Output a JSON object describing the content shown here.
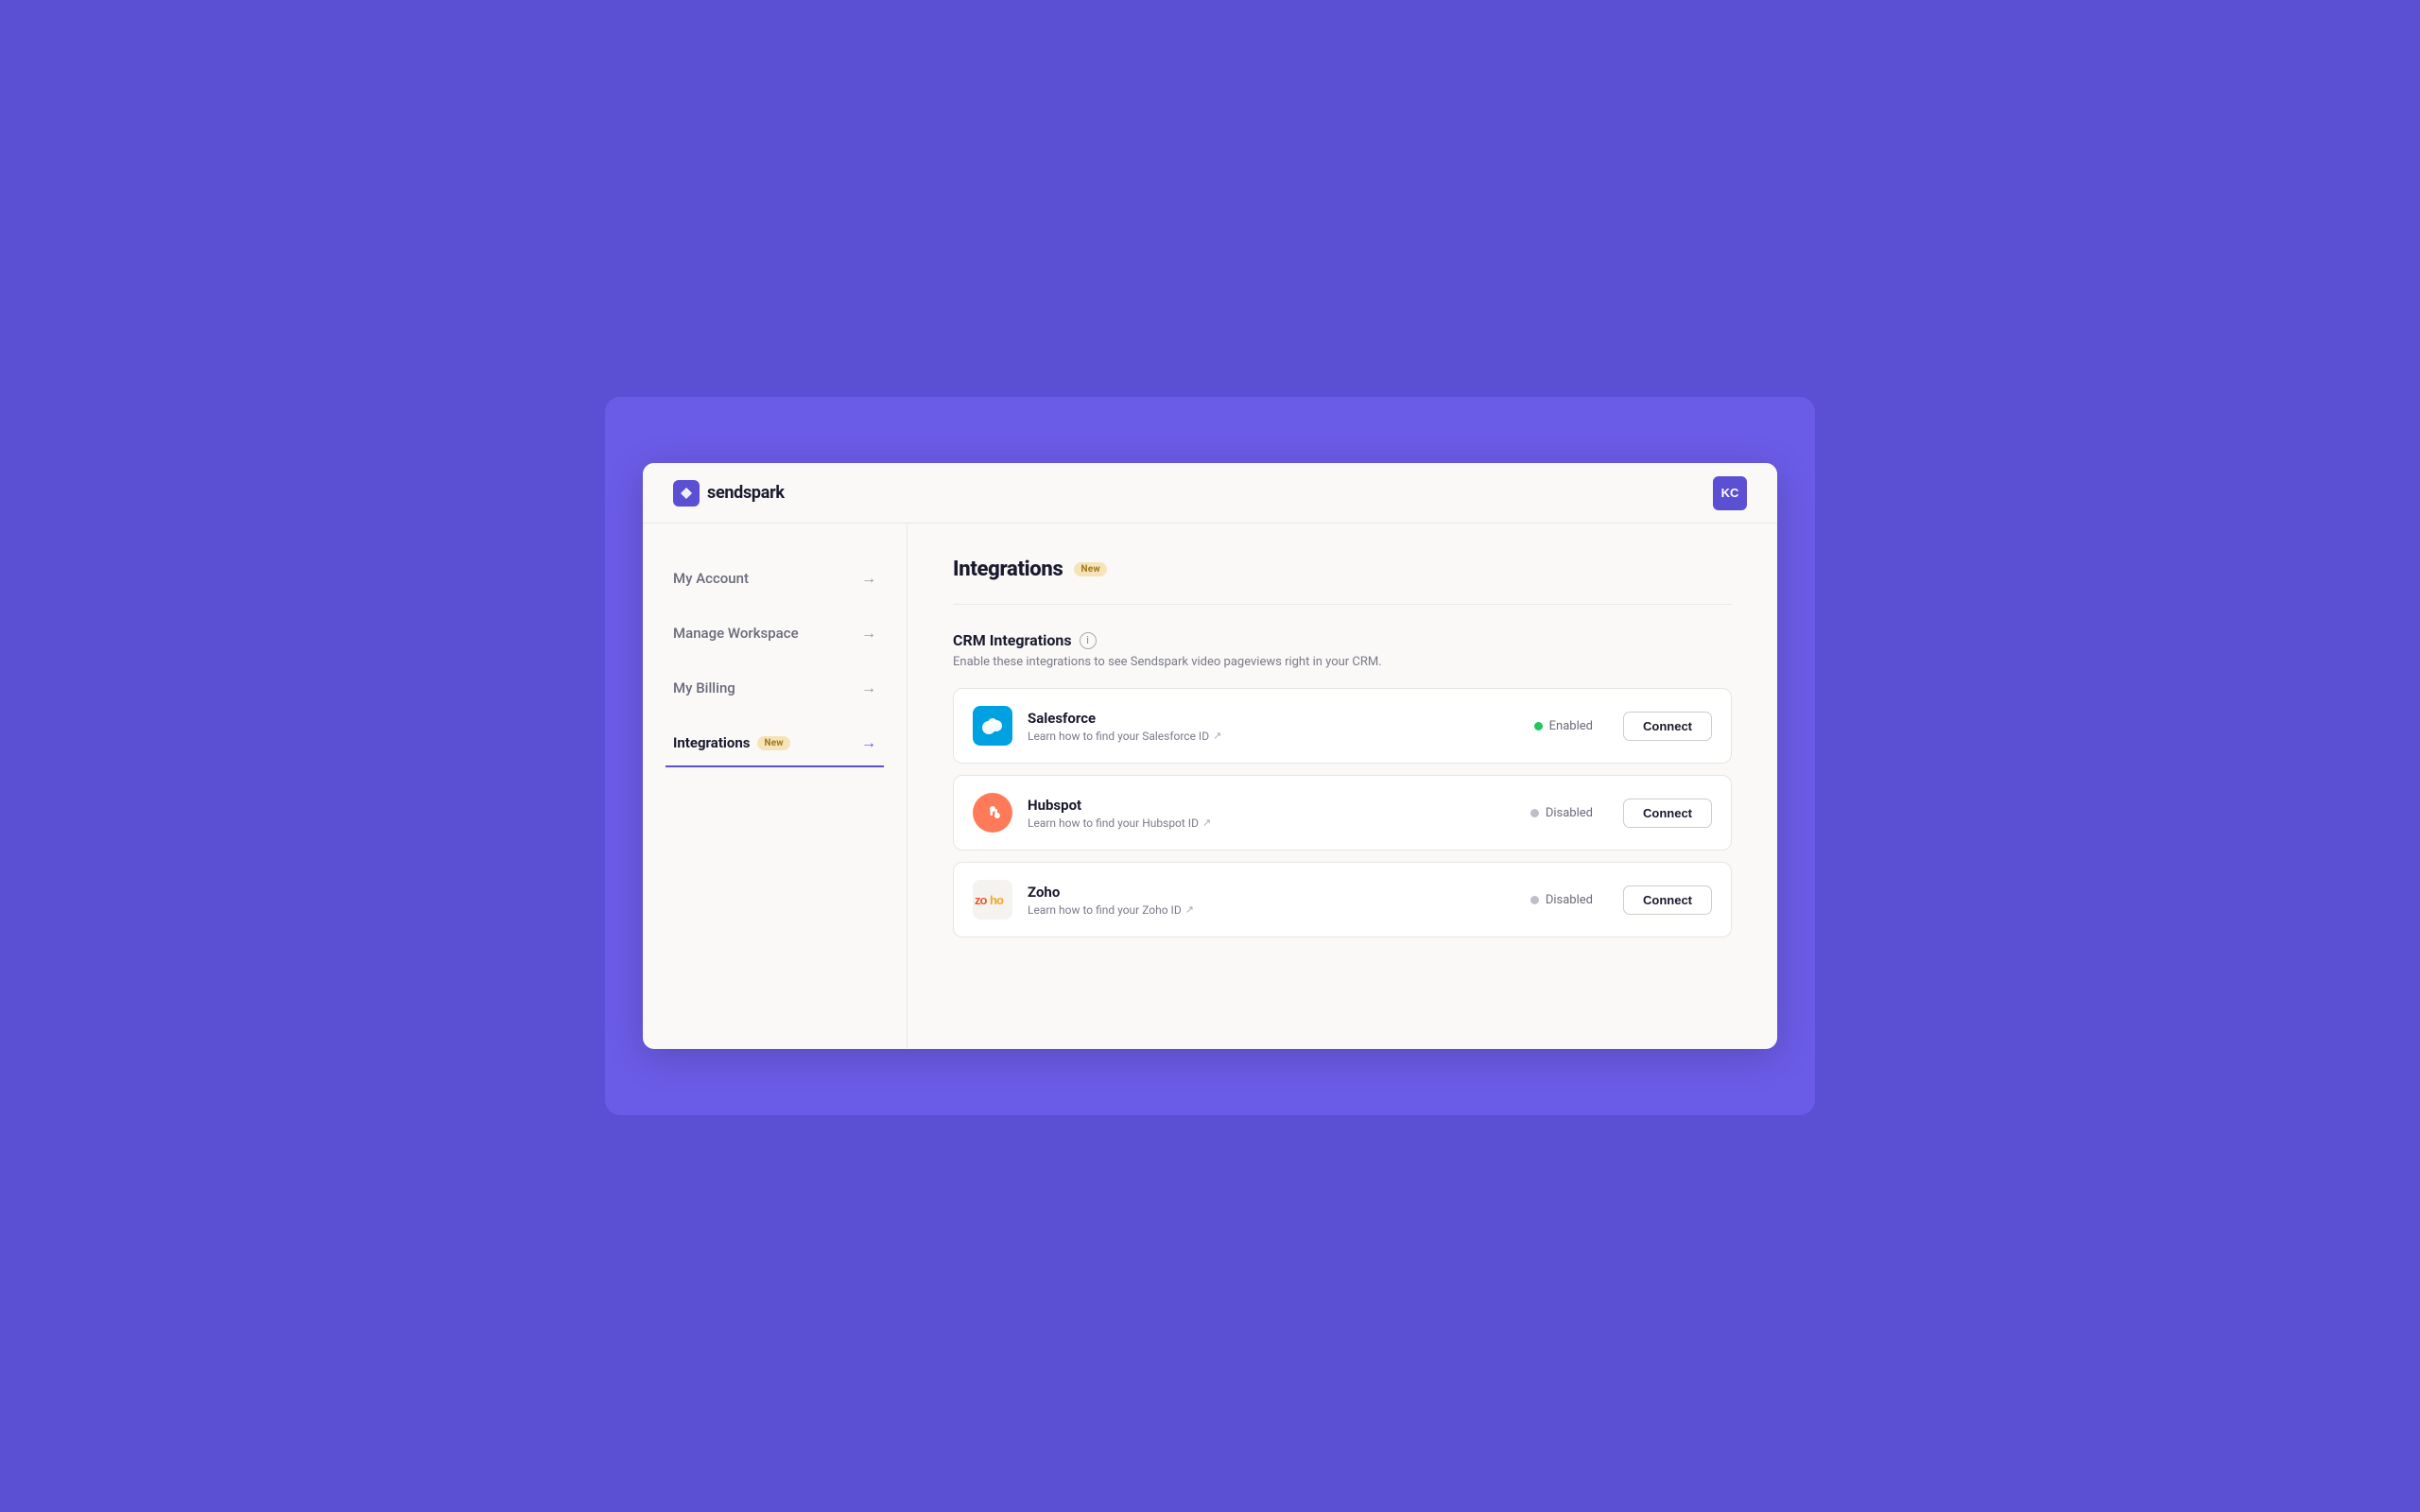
{
  "header": {
    "logo_text": "sendspark",
    "avatar_initials": "KC"
  },
  "sidebar": {
    "items": [
      {
        "id": "my-account",
        "label": "My Account",
        "badge": null,
        "active": false
      },
      {
        "id": "manage-workspace",
        "label": "Manage Workspace",
        "badge": null,
        "active": false
      },
      {
        "id": "my-billing",
        "label": "My Billing",
        "badge": null,
        "active": false
      },
      {
        "id": "integrations",
        "label": "Integrations",
        "badge": "New",
        "active": true
      }
    ]
  },
  "content": {
    "page_title": "Integrations",
    "page_badge": "New",
    "crm_section": {
      "title": "CRM Integrations",
      "description": "Enable these integrations to see Sendspark video pageviews right in your CRM.",
      "integrations": [
        {
          "id": "salesforce",
          "name": "Salesforce",
          "link_text": "Learn how to find your Salesforce ID",
          "status": "Enabled",
          "status_type": "enabled",
          "button_label": "Connect"
        },
        {
          "id": "hubspot",
          "name": "Hubspot",
          "link_text": "Learn how to find your Hubspot ID",
          "status": "Disabled",
          "status_type": "disabled",
          "button_label": "Connect"
        },
        {
          "id": "zoho",
          "name": "Zoho",
          "link_text": "Learn how to find your Zoho ID",
          "status": "Disabled",
          "status_type": "disabled",
          "button_label": "Connect"
        }
      ]
    }
  },
  "icons": {
    "arrow_right": "→",
    "external_link": "↗",
    "info": "i"
  }
}
